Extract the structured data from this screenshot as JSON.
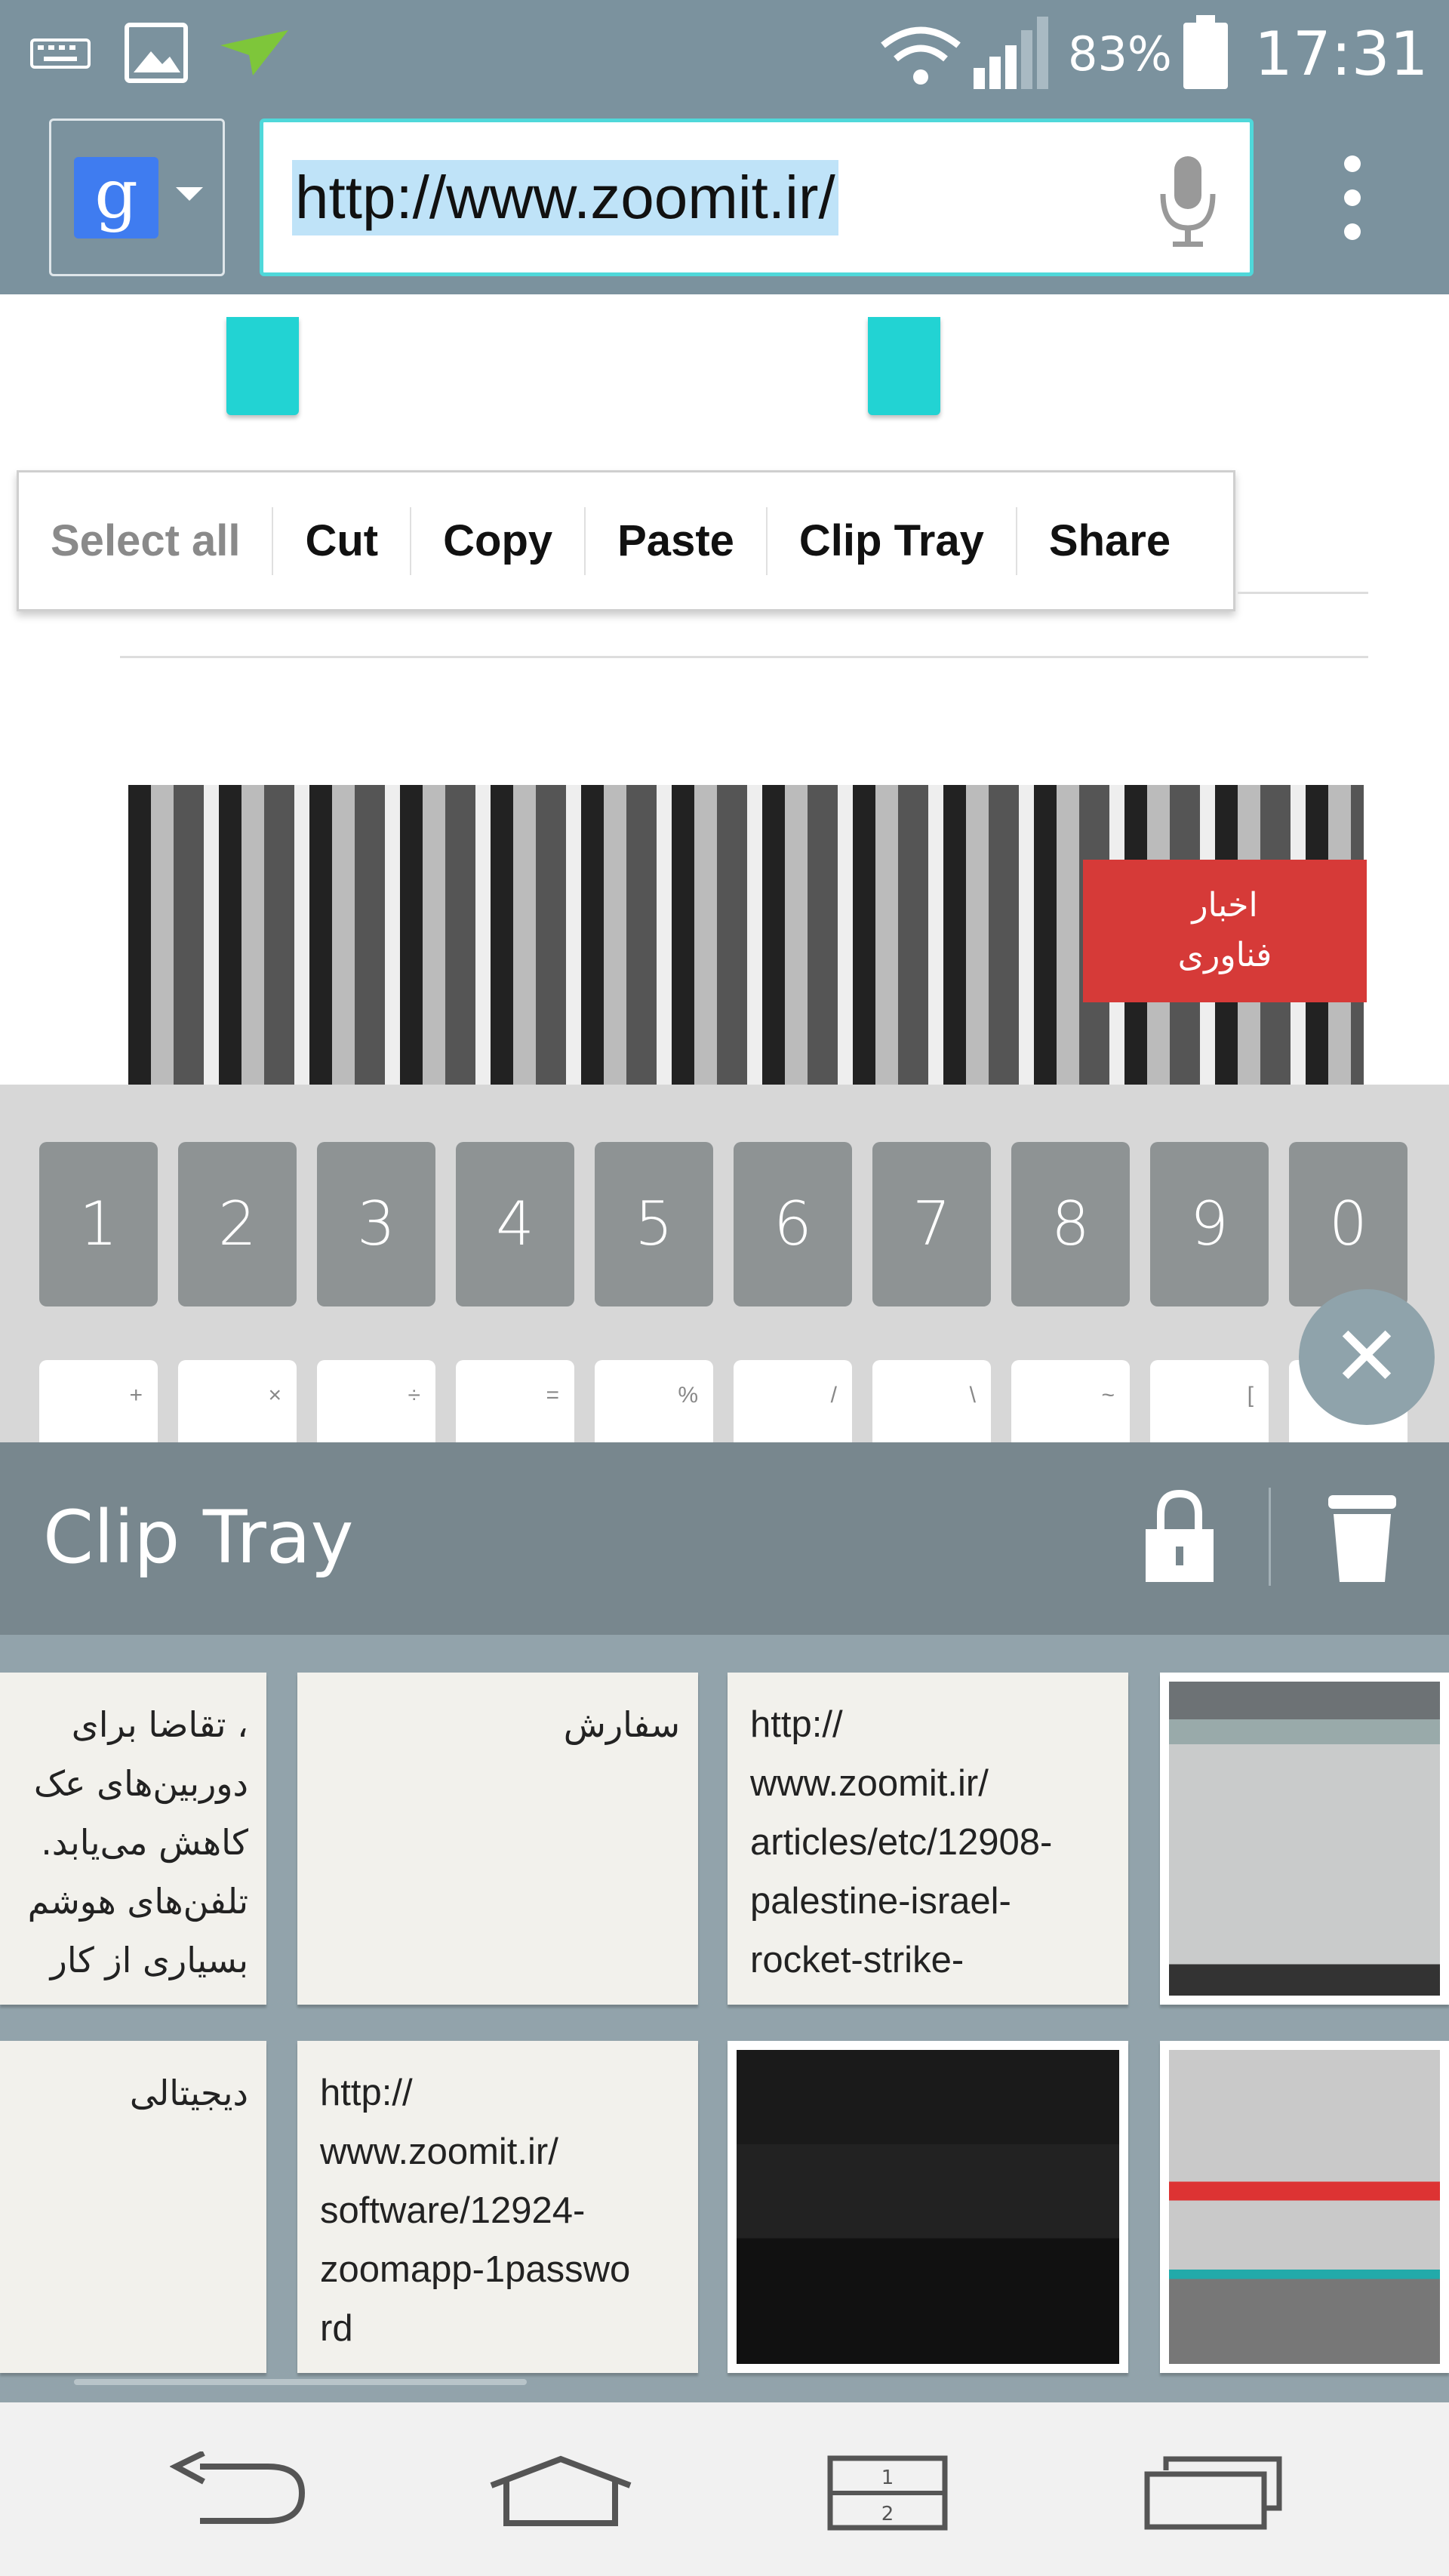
{
  "status_bar": {
    "icons": [
      "keyboard-icon",
      "image-icon",
      "send-icon",
      "wifi-icon",
      "signal-icon",
      "battery-icon"
    ],
    "battery": "83%",
    "time": "17:31"
  },
  "toolbar": {
    "search_engine": "g",
    "url": "http://www.zoomit.ir/",
    "icons": [
      "google-icon",
      "chevron-down-icon",
      "mic-icon",
      "overflow-menu-icon"
    ]
  },
  "context_menu": {
    "items": [
      "Select all",
      "Cut",
      "Copy",
      "Paste",
      "Clip Tray",
      "Share"
    ]
  },
  "page": {
    "badge_line1": "اخبار",
    "badge_line2": "فناوری"
  },
  "keyboard": {
    "numbers": [
      "1",
      "2",
      "3",
      "4",
      "5",
      "6",
      "7",
      "8",
      "9",
      "0"
    ],
    "symbols": [
      "+",
      "×",
      "÷",
      "=",
      "%",
      "/",
      "\\",
      "~",
      "[",
      ""
    ]
  },
  "clip_tray": {
    "title": "Clip Tray",
    "icons": [
      "lock-icon",
      "trash-icon",
      "close-icon"
    ],
    "row1": [
      {
        "type": "text",
        "lines": [
          "، تقاضا برای",
          "دوربین‌های عک",
          "کاهش می‌یابد.",
          "تلفن‌های هوشم",
          "بسیاری از کار"
        ]
      },
      {
        "type": "text",
        "lines": [
          "سفارش"
        ]
      },
      {
        "type": "text",
        "lines": [
          "http://",
          "www.zoomit.ir/",
          "articles/etc/12908-",
          "palestine-israel-",
          "rocket-strike-"
        ]
      },
      {
        "type": "image"
      }
    ],
    "row2": [
      {
        "type": "text",
        "lines": [
          "دیجیتالی"
        ]
      },
      {
        "type": "text",
        "lines": [
          "http://",
          "www.zoomit.ir/",
          "software/12924-",
          "zoomapp-1passwo",
          "rd"
        ]
      },
      {
        "type": "image"
      },
      {
        "type": "image"
      }
    ]
  },
  "nav_bar": {
    "icons": [
      "back-icon",
      "home-icon",
      "dual-window-icon",
      "recent-apps-icon"
    ]
  },
  "colors": {
    "toolbar": "#7b929e",
    "accent": "#22d3d3",
    "tray_header": "#78878e",
    "badge": "#d63a38"
  }
}
